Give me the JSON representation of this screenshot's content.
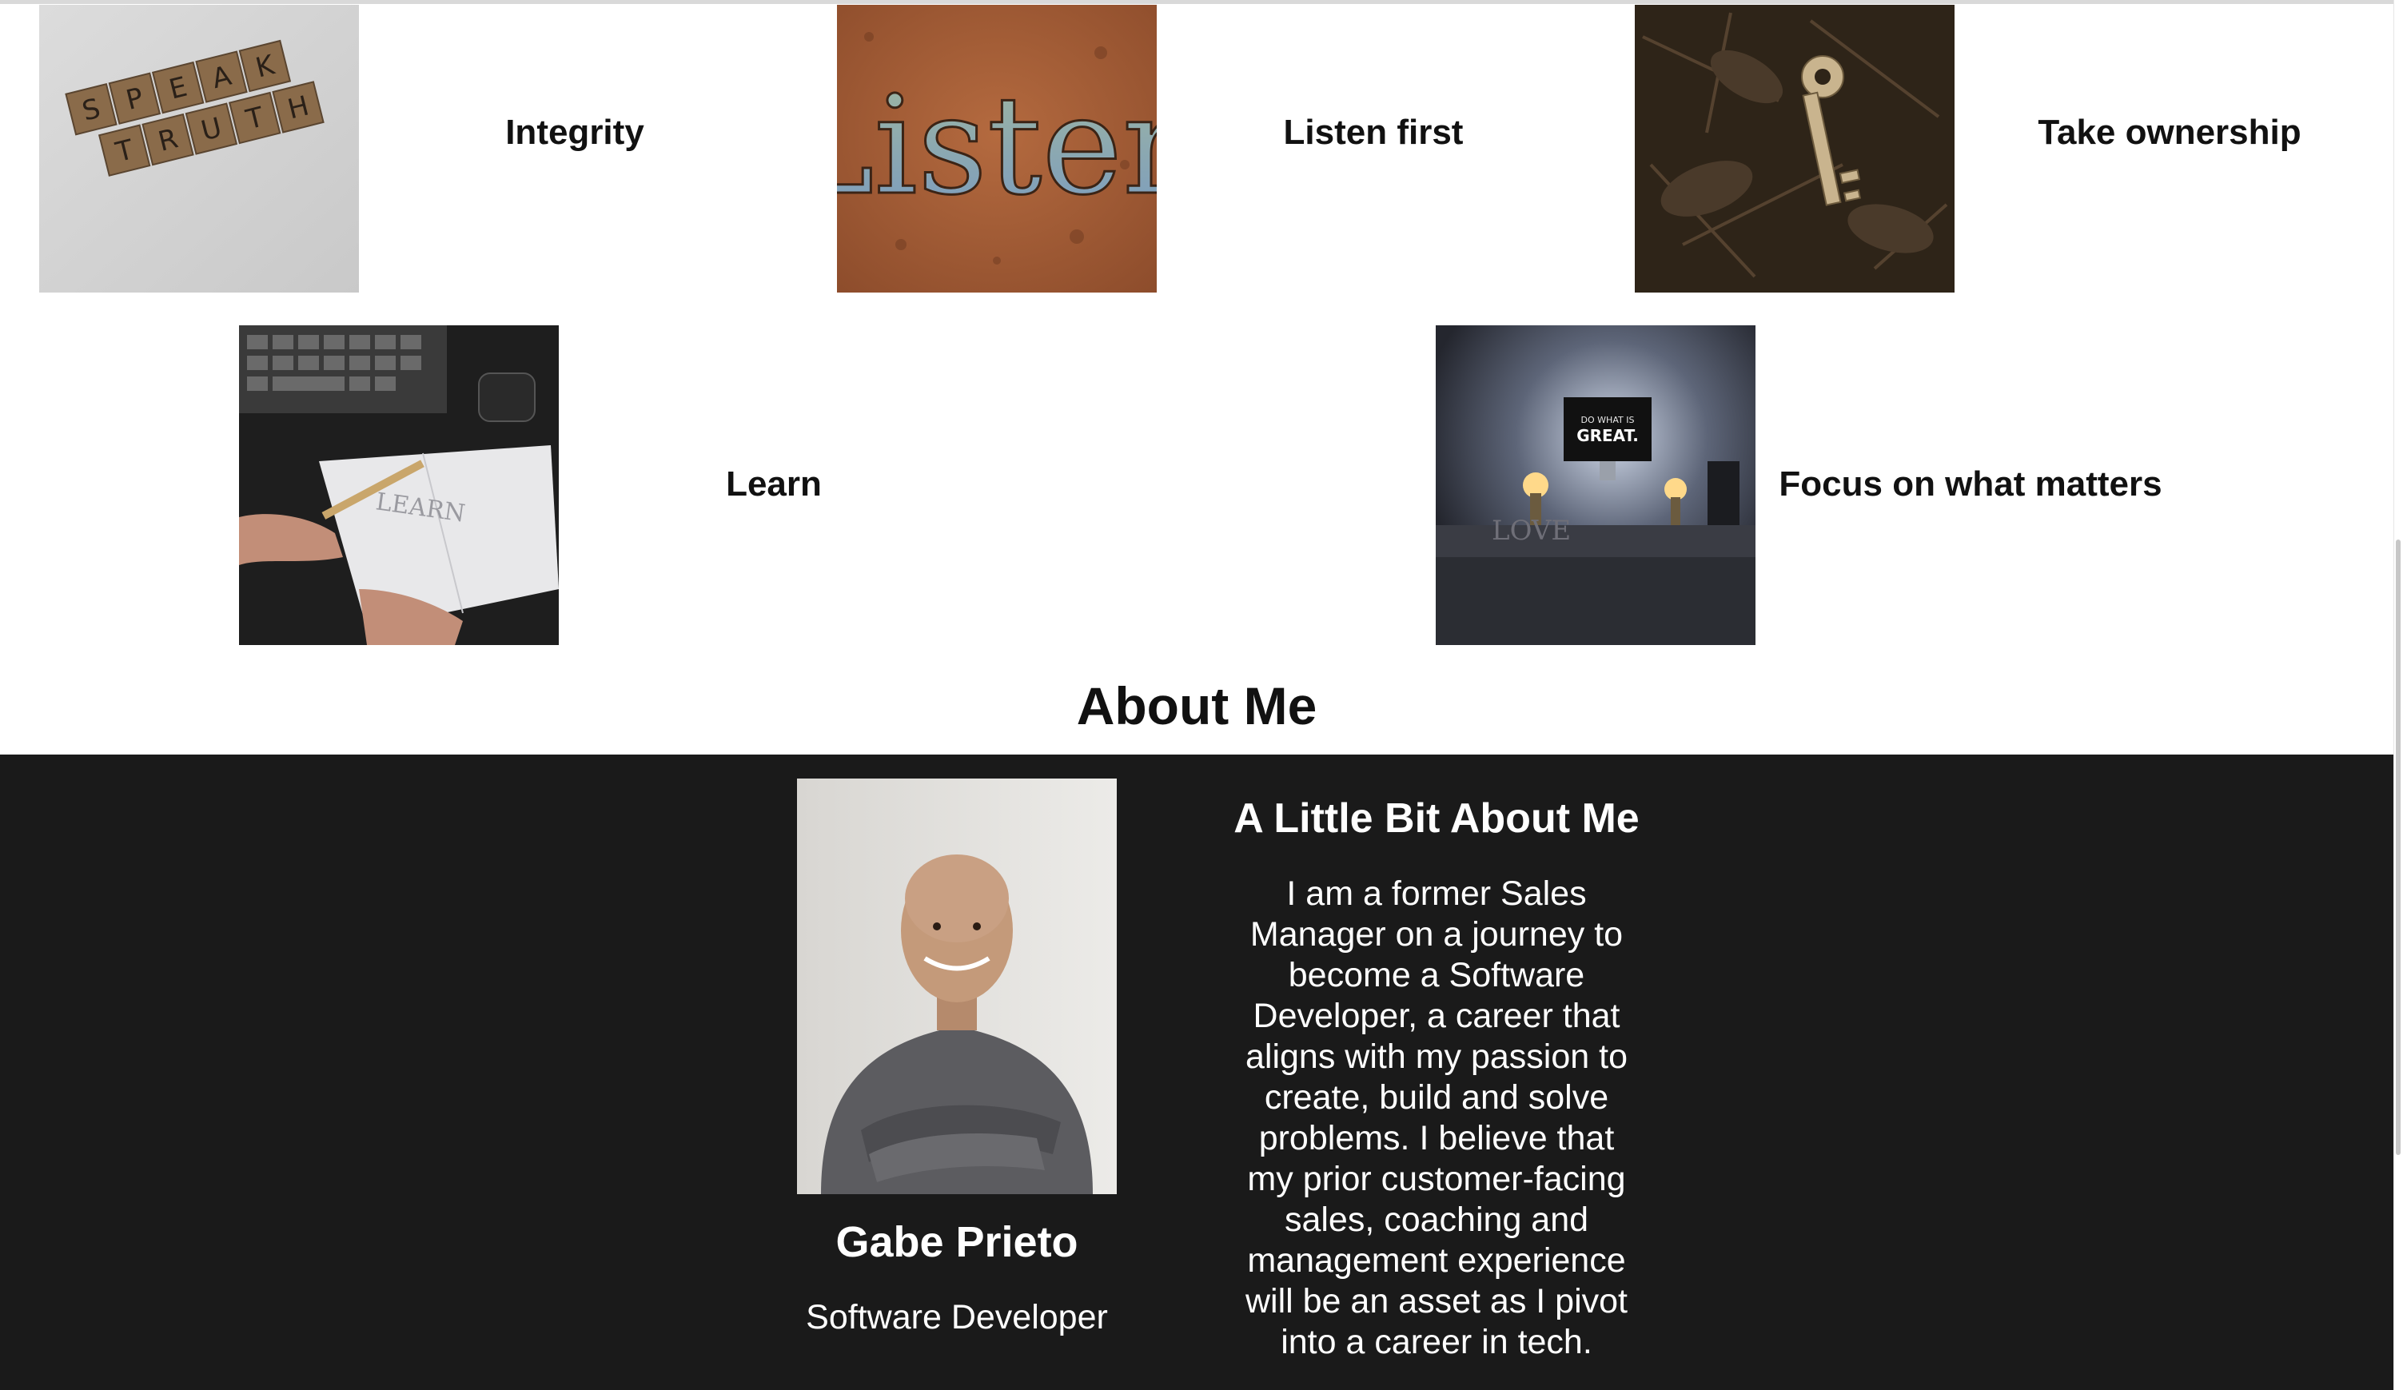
{
  "values": [
    {
      "label": "Integrity",
      "image": "speak-truth-scrabble-tiles",
      "image_text": "SPEAK TRUTH"
    },
    {
      "label": "Listen first",
      "image": "rusted-metal-listen-cutout",
      "image_text": "Listen"
    },
    {
      "label": "Take ownership",
      "image": "key-on-leaves"
    },
    {
      "label": "Learn",
      "image": "hand-writing-notebook",
      "image_text": "LEARN"
    },
    {
      "label": "Focus on what matters",
      "image": "desk-monitor-setup",
      "image_text": "DO WHAT IS GREAT."
    }
  ],
  "about": {
    "heading": "About Me",
    "name": "Gabe Prieto",
    "role": "Software Developer",
    "subheading": "A Little Bit About Me",
    "bio": "I am a former Sales Manager on a journey to become a Software Developer, a career that aligns with my passion to create, build and solve problems. I believe that my prior customer-facing sales, coaching and management experience will be an asset as I pivot into a career in tech."
  },
  "colors": {
    "band_background": "#1a1a1a",
    "text_dark": "#111111",
    "text_light": "#ffffff"
  }
}
